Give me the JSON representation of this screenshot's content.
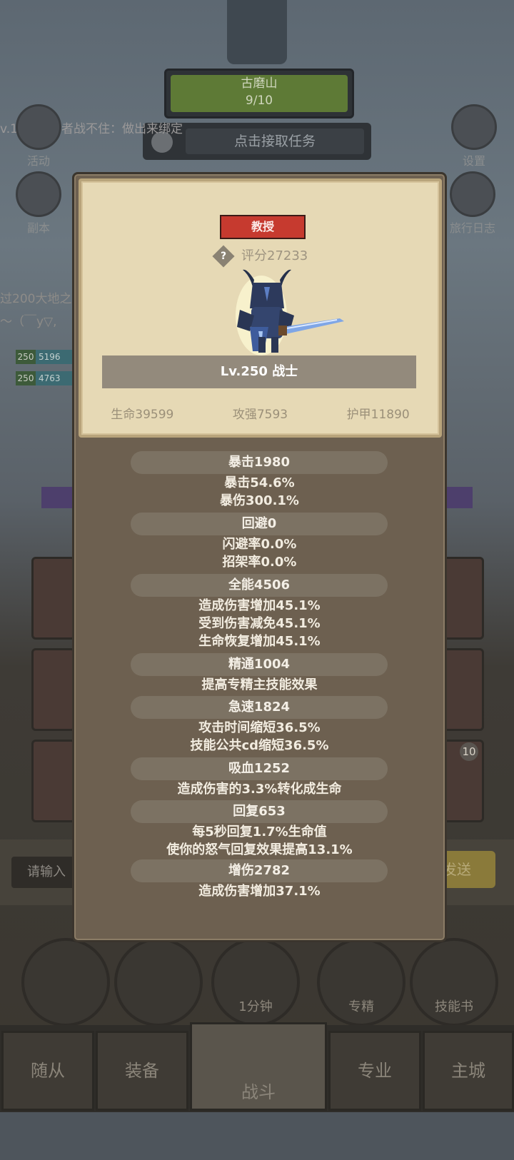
{
  "background": {
    "quest_name": "古磨山",
    "quest_progress": "9/10",
    "task_button": "点击接取任务",
    "notice_text": "v.139 搜寻者战不住：做出来绑定",
    "side_left": [
      "活动",
      "副本"
    ],
    "side_right": [
      "设置",
      "旅行日志"
    ],
    "partial_lines": [
      "过200大地之",
      "～（￣y▽,"
    ],
    "level_chips": [
      {
        "level": "250",
        "value": "5196"
      },
      {
        "level": "250",
        "value": "4763"
      }
    ],
    "input_placeholder": "请输入",
    "send_label": "发送",
    "badge_count": "10",
    "round_buttons": [
      "",
      "",
      "1分钟",
      "专精",
      "技能书"
    ],
    "nav_tabs": [
      "随从",
      "装备",
      "战斗",
      "专业",
      "主城"
    ]
  },
  "modal": {
    "rank": "教授",
    "score_label": "评分27233",
    "help_glyph": "?",
    "level_class": "Lv.250 战士",
    "base_stats": [
      "生命39599",
      "攻强7593",
      "护甲11890"
    ],
    "stats": [
      {
        "title": "暴击1980",
        "lines": [
          "暴击54.6%",
          "暴伤300.1%"
        ]
      },
      {
        "title": "回避0",
        "lines": [
          "闪避率0.0%",
          "招架率0.0%"
        ]
      },
      {
        "title": "全能4506",
        "lines": [
          "造成伤害增加45.1%",
          "受到伤害减免45.1%",
          "生命恢复增加45.1%"
        ]
      },
      {
        "title": "精通1004",
        "lines": [
          "提高专精主技能效果"
        ]
      },
      {
        "title": "急速1824",
        "lines": [
          "攻击时间缩短36.5%",
          "技能公共cd缩短36.5%"
        ]
      },
      {
        "title": "吸血1252",
        "lines": [
          "造成伤害的3.3%转化成生命"
        ]
      },
      {
        "title": "回复653",
        "lines": [
          "每5秒回复1.7%生命值",
          "使你的怒气回复效果提高13.1%"
        ]
      },
      {
        "title": "增伤2782",
        "lines": [
          "造成伤害增加37.1%"
        ]
      }
    ]
  }
}
